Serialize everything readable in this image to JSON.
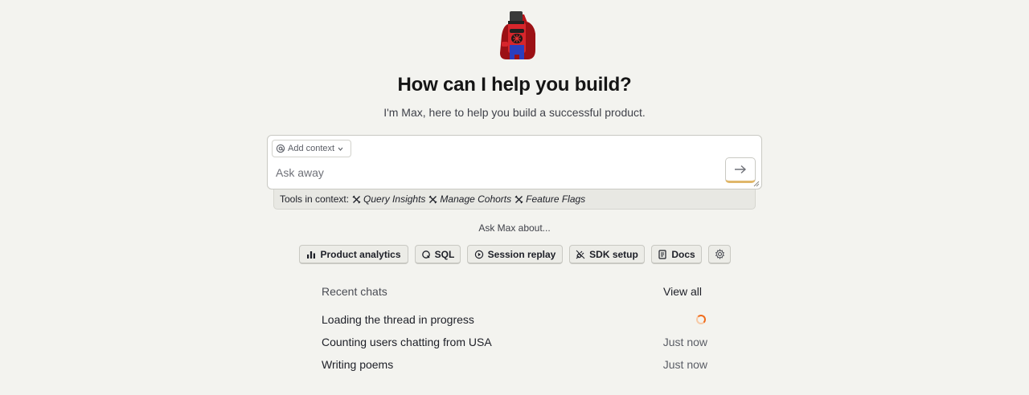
{
  "hero": {
    "headline": "How can I help you build?",
    "subline": "I'm Max, here to help you build a successful product."
  },
  "input": {
    "context_button_label": "Add context",
    "placeholder": "Ask away"
  },
  "tools": {
    "prefix": "Tools in context:",
    "items": [
      "Query Insights",
      "Manage Cohorts",
      "Feature Flags"
    ]
  },
  "ask_about": "Ask Max about...",
  "suggestions": [
    {
      "label": "Product analytics",
      "icon": "bar-chart-icon"
    },
    {
      "label": "SQL",
      "icon": "hog-ql-icon"
    },
    {
      "label": "Session replay",
      "icon": "replay-icon"
    },
    {
      "label": "SDK setup",
      "icon": "plug-icon"
    },
    {
      "label": "Docs",
      "icon": "book-icon"
    },
    {
      "label": "",
      "icon": "gear-icon"
    }
  ],
  "recent": {
    "title": "Recent chats",
    "view_all": "View all",
    "chats": [
      {
        "title": "Loading the thread in progress",
        "status": "loading"
      },
      {
        "title": "Counting users chatting from USA",
        "time": "Just now"
      },
      {
        "title": "Writing poems",
        "time": "Just now"
      }
    ]
  },
  "colors": {
    "background": "#f3f3ef",
    "send_accent": "#e0b76a",
    "spinner": "#f06b1a"
  }
}
